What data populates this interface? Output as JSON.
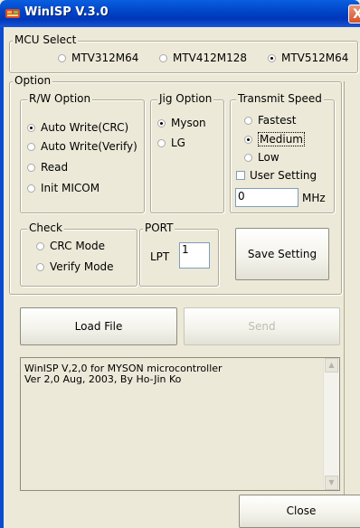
{
  "window": {
    "title": "WinISP V.3.0",
    "close_glyph": "X"
  },
  "mcu": {
    "title": "MCU Select",
    "options": [
      {
        "label": "MTV312M64",
        "selected": false
      },
      {
        "label": "MTV412M128",
        "selected": false
      },
      {
        "label": "MTV512M64",
        "selected": true
      }
    ]
  },
  "option_group": {
    "title": "Option"
  },
  "rw": {
    "title": "R/W Option",
    "options": [
      {
        "label": "Auto Write(CRC)",
        "selected": true
      },
      {
        "label": "Auto Write(Verify)",
        "selected": false
      },
      {
        "label": "Read",
        "selected": false
      },
      {
        "label": "Init MICOM",
        "selected": false
      }
    ]
  },
  "jig": {
    "title": "Jig Option",
    "options": [
      {
        "label": "Myson",
        "selected": true
      },
      {
        "label": "LG",
        "selected": false
      }
    ]
  },
  "speed": {
    "title": "Transmit Speed",
    "options": [
      {
        "label": "Fastest",
        "selected": false
      },
      {
        "label": "Medium",
        "selected": true
      },
      {
        "label": "Low",
        "selected": false
      }
    ],
    "user_setting_label": "User Setting",
    "user_setting_checked": false,
    "value": "0",
    "unit": "MHz"
  },
  "check": {
    "title": "Check",
    "options": [
      {
        "label": "CRC Mode",
        "selected": false
      },
      {
        "label": "Verify Mode",
        "selected": false
      }
    ]
  },
  "port": {
    "title": "PORT",
    "label": "LPT",
    "value": "1"
  },
  "buttons": {
    "save": "Save Setting",
    "load": "Load File",
    "send": "Send",
    "close": "Close"
  },
  "log": {
    "lines": [
      "WinISP V,2,0 for MYSON microcontroller",
      "Ver 2,0 Aug, 2003, By Ho-Jin Ko"
    ]
  },
  "colors": {
    "titlebar": "#0043c6",
    "face": "#ece9d8"
  }
}
